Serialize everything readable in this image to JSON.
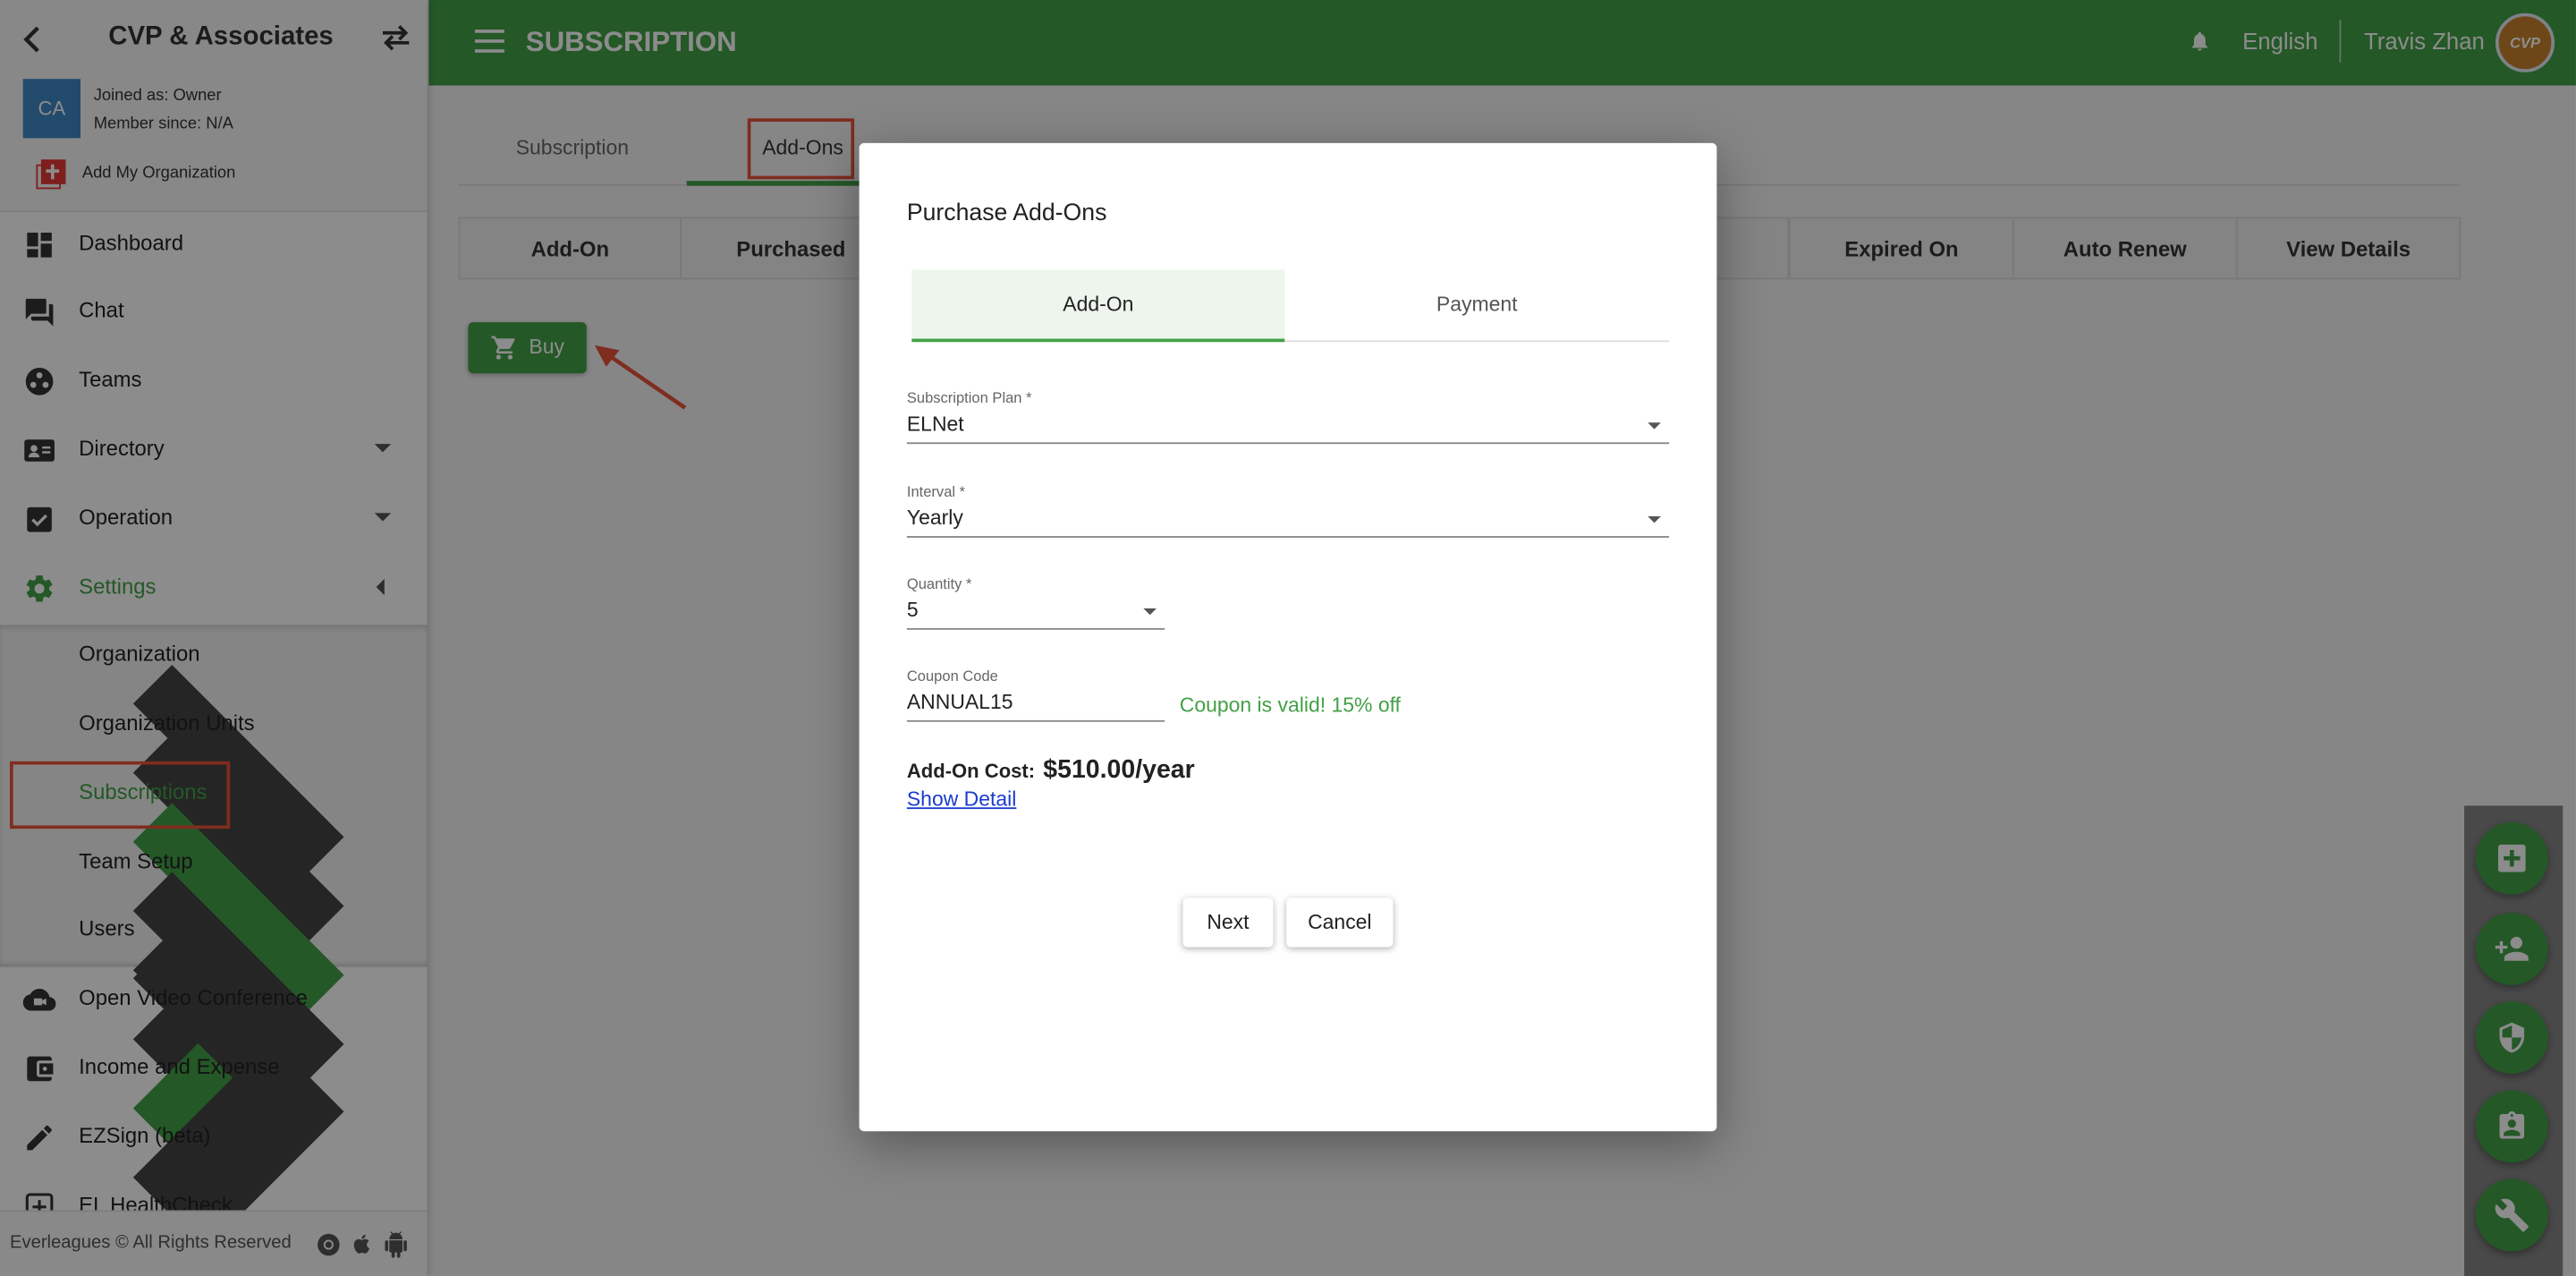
{
  "org": {
    "name": "CVP & Associates",
    "initials": "CA",
    "joined": "Joined as: Owner",
    "member_since": "Member since: N/A",
    "add_org": "Add My Organization"
  },
  "sidebar": {
    "items": [
      {
        "label": "Dashboard",
        "icon": "dashboard-icon"
      },
      {
        "label": "Chat",
        "icon": "chat-icon"
      },
      {
        "label": "Teams",
        "icon": "teams-icon"
      },
      {
        "label": "Directory",
        "icon": "directory-icon"
      },
      {
        "label": "Operation",
        "icon": "operation-icon"
      },
      {
        "label": "Settings",
        "icon": "gear-icon"
      },
      {
        "label": "Open Video Conference",
        "icon": "video-icon"
      },
      {
        "label": "Income and Expense",
        "icon": "wallet-icon"
      },
      {
        "label": "EZSign (beta)",
        "icon": "pen-icon"
      },
      {
        "label": "EL HealthCheck",
        "icon": "health-icon"
      }
    ],
    "settings_sub": [
      {
        "label": "Organization"
      },
      {
        "label": "Organization Units"
      },
      {
        "label": "Subscriptions"
      },
      {
        "label": "Team Setup"
      },
      {
        "label": "Users"
      }
    ],
    "footer": "Everleagues © All Rights Reserved"
  },
  "header": {
    "title": "SUBSCRIPTION",
    "language": "English",
    "user": "Travis Zhan",
    "avatar_text": "CVP"
  },
  "tabs": [
    {
      "label": "Subscription"
    },
    {
      "label": "Add-Ons"
    }
  ],
  "table": {
    "columns": [
      "Add-On",
      "Purchased",
      "Expired On",
      "Auto Renew",
      "View Details"
    ]
  },
  "buy_label": "Buy",
  "modal": {
    "title": "Purchase Add-Ons",
    "tabs": [
      {
        "label": "Add-On"
      },
      {
        "label": "Payment"
      }
    ],
    "plan_label": "Subscription Plan *",
    "plan_value": "ELNet",
    "interval_label": "Interval *",
    "interval_value": "Yearly",
    "quantity_label": "Quantity *",
    "quantity_value": "5",
    "coupon_label": "Coupon Code",
    "coupon_value": "ANNUAL15",
    "coupon_status": "Coupon is valid! 15% off",
    "cost_label": "Add-On Cost:",
    "cost_value": "$510.00/year",
    "show_detail": "Show Detail",
    "next": "Next",
    "cancel": "Cancel"
  },
  "colors": {
    "brand_green": "#43a047",
    "success_text": "#43a047",
    "highlight_red": "#e8523a",
    "link_blue": "#1a3ccf"
  }
}
